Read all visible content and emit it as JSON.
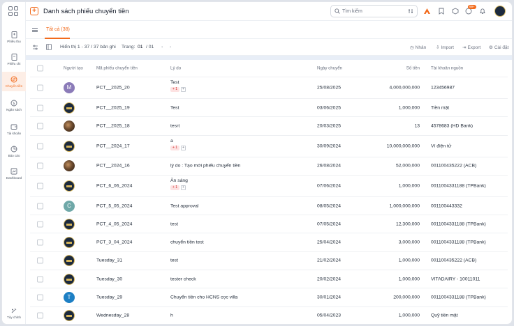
{
  "header": {
    "title": "Danh sách phiếu chuyển tiền",
    "search_placeholder": "Tìm kiếm",
    "notification_badge": "99+"
  },
  "sidebar": {
    "items": [
      {
        "label": "Phiếu thu",
        "icon": "receipt-in-icon"
      },
      {
        "label": "Phiếu chi",
        "icon": "receipt-out-icon"
      },
      {
        "label": "Chuyển tiền",
        "icon": "transfer-icon",
        "active": true
      },
      {
        "label": "Ngân sách",
        "icon": "budget-icon"
      },
      {
        "label": "Tài khoản",
        "icon": "wallet-icon"
      },
      {
        "label": "Báo cáo",
        "icon": "pie-chart-icon"
      },
      {
        "label": "Dashboard",
        "icon": "dashboard-icon"
      }
    ],
    "customize_label": "Tùy chỉnh"
  },
  "tabs": [
    {
      "label": "Tất cả (38)",
      "active": true
    }
  ],
  "toolbar": {
    "display_text": "Hiển thị 1 - 37 / 37 bản ghi",
    "page_label": "Trang:",
    "page_current": "01",
    "page_total": "/ 01",
    "actions": {
      "clone": "Nhân",
      "import": "Import",
      "export": "Export",
      "settings": "Cài đặt"
    }
  },
  "table": {
    "columns": {
      "creator": "Người tạo",
      "code": "Mã phiếu chuyển tiền",
      "reason": "Lý do",
      "date": "Ngày chuyển",
      "amount": "Số tiền",
      "source": "Tài khoản nguồn"
    },
    "rows": [
      {
        "avatar": "M",
        "avatar_color": "#8b7bb8",
        "code": "PCT__2025_20",
        "reason": "Test",
        "tag": "+ 1",
        "date": "25/08/2025",
        "amount": "4,000,000,000",
        "source": "123456987"
      },
      {
        "avatar": "",
        "avatar_type": "logo",
        "code": "PCT__2025_19",
        "reason": "Test",
        "date": "03/06/2025",
        "amount": "1,000,000",
        "source": "Tiền mặt"
      },
      {
        "avatar": "",
        "avatar_type": "photo",
        "code": "PCT__2025_18",
        "reason": "tesrt",
        "date": "20/03/2025",
        "amount": "13",
        "source": "4578683 (HD Bank)"
      },
      {
        "avatar": "",
        "avatar_type": "logo",
        "code": "PCT__2024_17",
        "reason": "a",
        "tag": "+ 1",
        "date": "30/09/2024",
        "amount": "10,000,000,000",
        "source": "Ví điện tử"
      },
      {
        "avatar": "",
        "avatar_type": "photo",
        "code": "PCT__2024_16",
        "reason": "lý do : Tạo mới phiếu chuyển tiền",
        "date": "26/08/2024",
        "amount": "52,000,000",
        "source": "001100435222 (ACB)"
      },
      {
        "avatar": "",
        "avatar_type": "logo",
        "code": "PCT_6_06_2024",
        "reason": "Ăn sáng",
        "tag": "+ 1",
        "date": "07/06/2024",
        "amount": "1,000,000",
        "source": "0011004331188 (TPBank)"
      },
      {
        "avatar": "C",
        "avatar_color": "#6fa8a8",
        "code": "PCT_5_05_2024",
        "reason": "Test approval",
        "date": "08/05/2024",
        "amount": "1,000,000,000",
        "source": "001100443332"
      },
      {
        "avatar": "",
        "avatar_type": "logo",
        "code": "PCT_4_05_2024",
        "reason": "test",
        "date": "07/05/2024",
        "amount": "12,300,000",
        "source": "0011004331188 (TPBank)"
      },
      {
        "avatar": "",
        "avatar_type": "logo",
        "code": "PCT_3_04_2024",
        "reason": "chuyển tiền test",
        "date": "25/04/2024",
        "amount": "3,000,000",
        "source": "0011004331188 (TPBank)"
      },
      {
        "avatar": "",
        "avatar_type": "logo",
        "code": "Tuesday_31",
        "reason": "test",
        "date": "21/02/2024",
        "amount": "1,000,000",
        "source": "001100435222 (ACB)"
      },
      {
        "avatar": "",
        "avatar_type": "logo",
        "code": "Tuesday_30",
        "reason": "tester check",
        "date": "20/02/2024",
        "amount": "1,000,000",
        "source": "VITADAIRY - 10011011"
      },
      {
        "avatar": "T",
        "avatar_color": "#1d7fc4",
        "code": "Tuesday_29",
        "reason": "Chuyển tiền cho HCNS cọc villa",
        "date": "30/01/2024",
        "amount": "200,000,000",
        "source": "0011004331188 (TPBank)"
      },
      {
        "avatar": "",
        "avatar_type": "logo",
        "code": "Wednesday_28",
        "reason": "h",
        "date": "05/04/2023",
        "amount": "1,000,000",
        "source": "Quỹ tiền mặt"
      }
    ]
  },
  "colors": {
    "accent": "#f26a1b",
    "tag_bg": "#fde2e2",
    "tag_text": "#d12b2b"
  }
}
